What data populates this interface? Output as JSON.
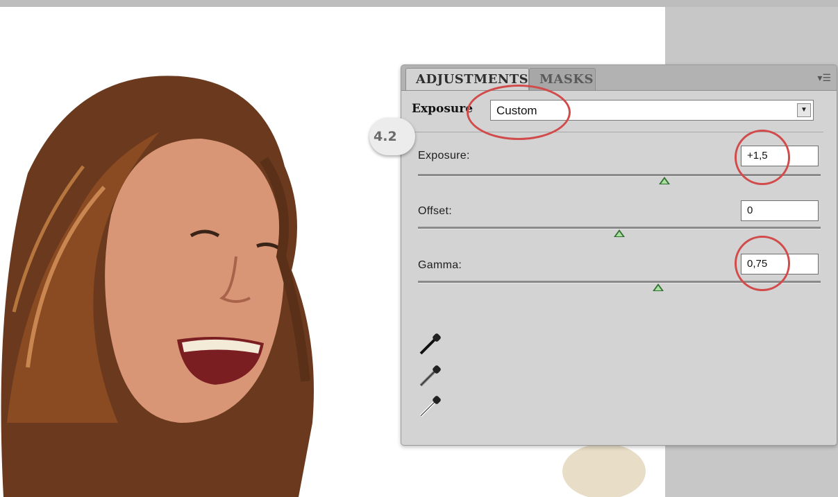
{
  "panel": {
    "tabs": [
      {
        "label": "ADJUSTMENTS",
        "active": true
      },
      {
        "label": "MASKS",
        "active": false
      }
    ],
    "menu_icon": "panel-menu-icon",
    "preset": {
      "label": "Exposure",
      "value": "Custom"
    },
    "controls": [
      {
        "label": "Exposure:",
        "value": "+1,5",
        "slider_fraction": 0.62
      },
      {
        "label": "Offset:",
        "value": "0",
        "slider_fraction": 0.5
      },
      {
        "label": "Gamma:",
        "value": "0,75",
        "slider_fraction": 0.6
      }
    ],
    "eyedroppers": [
      "black-point-eyedropper-icon",
      "gray-point-eyedropper-icon",
      "white-point-eyedropper-icon"
    ]
  },
  "annotation": {
    "step": "4.2",
    "highlight_color": "#d24b4b"
  },
  "colors": {
    "panel_bg": "#d3d3d3",
    "slider_thumb": "#2f6f2f"
  }
}
